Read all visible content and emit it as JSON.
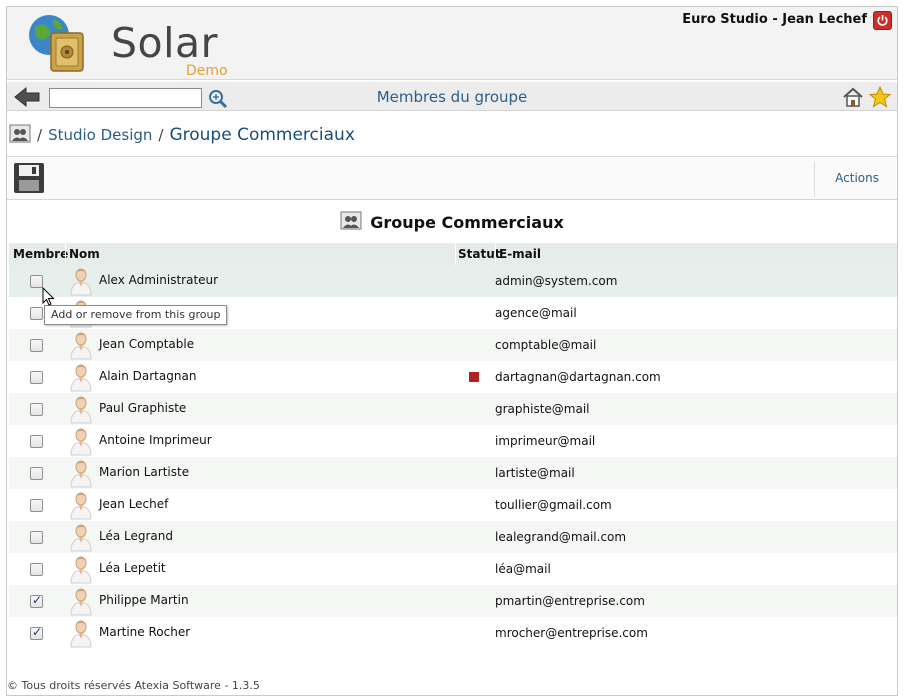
{
  "header": {
    "app_name": "Solar",
    "app_edition": "Demo",
    "user_label": "Euro Studio - Jean Lechef",
    "power_icon": "power-icon"
  },
  "toolbar": {
    "search_value": "",
    "page_title": "Membres du groupe",
    "icons": [
      "back-arrow-icon",
      "search-icon",
      "home-icon",
      "star-icon"
    ]
  },
  "breadcrumb": {
    "separator": "/",
    "parent": "Studio Design",
    "current": "Groupe Commerciaux"
  },
  "actionbar": {
    "actions_label": "Actions",
    "save_icon": "floppy-disk-icon"
  },
  "section": {
    "title": "Groupe Commerciaux"
  },
  "table": {
    "columns": {
      "member": "Membre",
      "name": "Nom",
      "status": "Statut",
      "email": "E-mail"
    },
    "rows": [
      {
        "name": "Alex Administrateur",
        "email": "admin@system.com",
        "member": false,
        "status": ""
      },
      {
        "name": "",
        "email": "agence@mail",
        "member": false,
        "status": ""
      },
      {
        "name": "Jean Comptable",
        "email": "comptable@mail",
        "member": false,
        "status": ""
      },
      {
        "name": "Alain Dartagnan",
        "email": "dartagnan@dartagnan.com",
        "member": false,
        "status": "inactive"
      },
      {
        "name": "Paul Graphiste",
        "email": "graphiste@mail",
        "member": false,
        "status": ""
      },
      {
        "name": "Antoine Imprimeur",
        "email": "imprimeur@mail",
        "member": false,
        "status": ""
      },
      {
        "name": "Marion Lartiste",
        "email": "lartiste@mail",
        "member": false,
        "status": ""
      },
      {
        "name": "Jean Lechef",
        "email": "toullier@gmail.com",
        "member": false,
        "status": ""
      },
      {
        "name": "Léa Legrand",
        "email": "lealegrand@mail.com",
        "member": false,
        "status": ""
      },
      {
        "name": "Léa Lepetit",
        "email": "léa@mail",
        "member": false,
        "status": ""
      },
      {
        "name": "Philippe Martin",
        "email": "pmartin@entreprise.com",
        "member": true,
        "status": ""
      },
      {
        "name": "Martine Rocher",
        "email": "mrocher@entreprise.com",
        "member": true,
        "status": ""
      }
    ],
    "status_color": "#b22222"
  },
  "tooltip": {
    "text": "Add or remove from this group"
  },
  "footer": {
    "text": "© Tous droits réservés Atexia Software - 1.3.5"
  }
}
